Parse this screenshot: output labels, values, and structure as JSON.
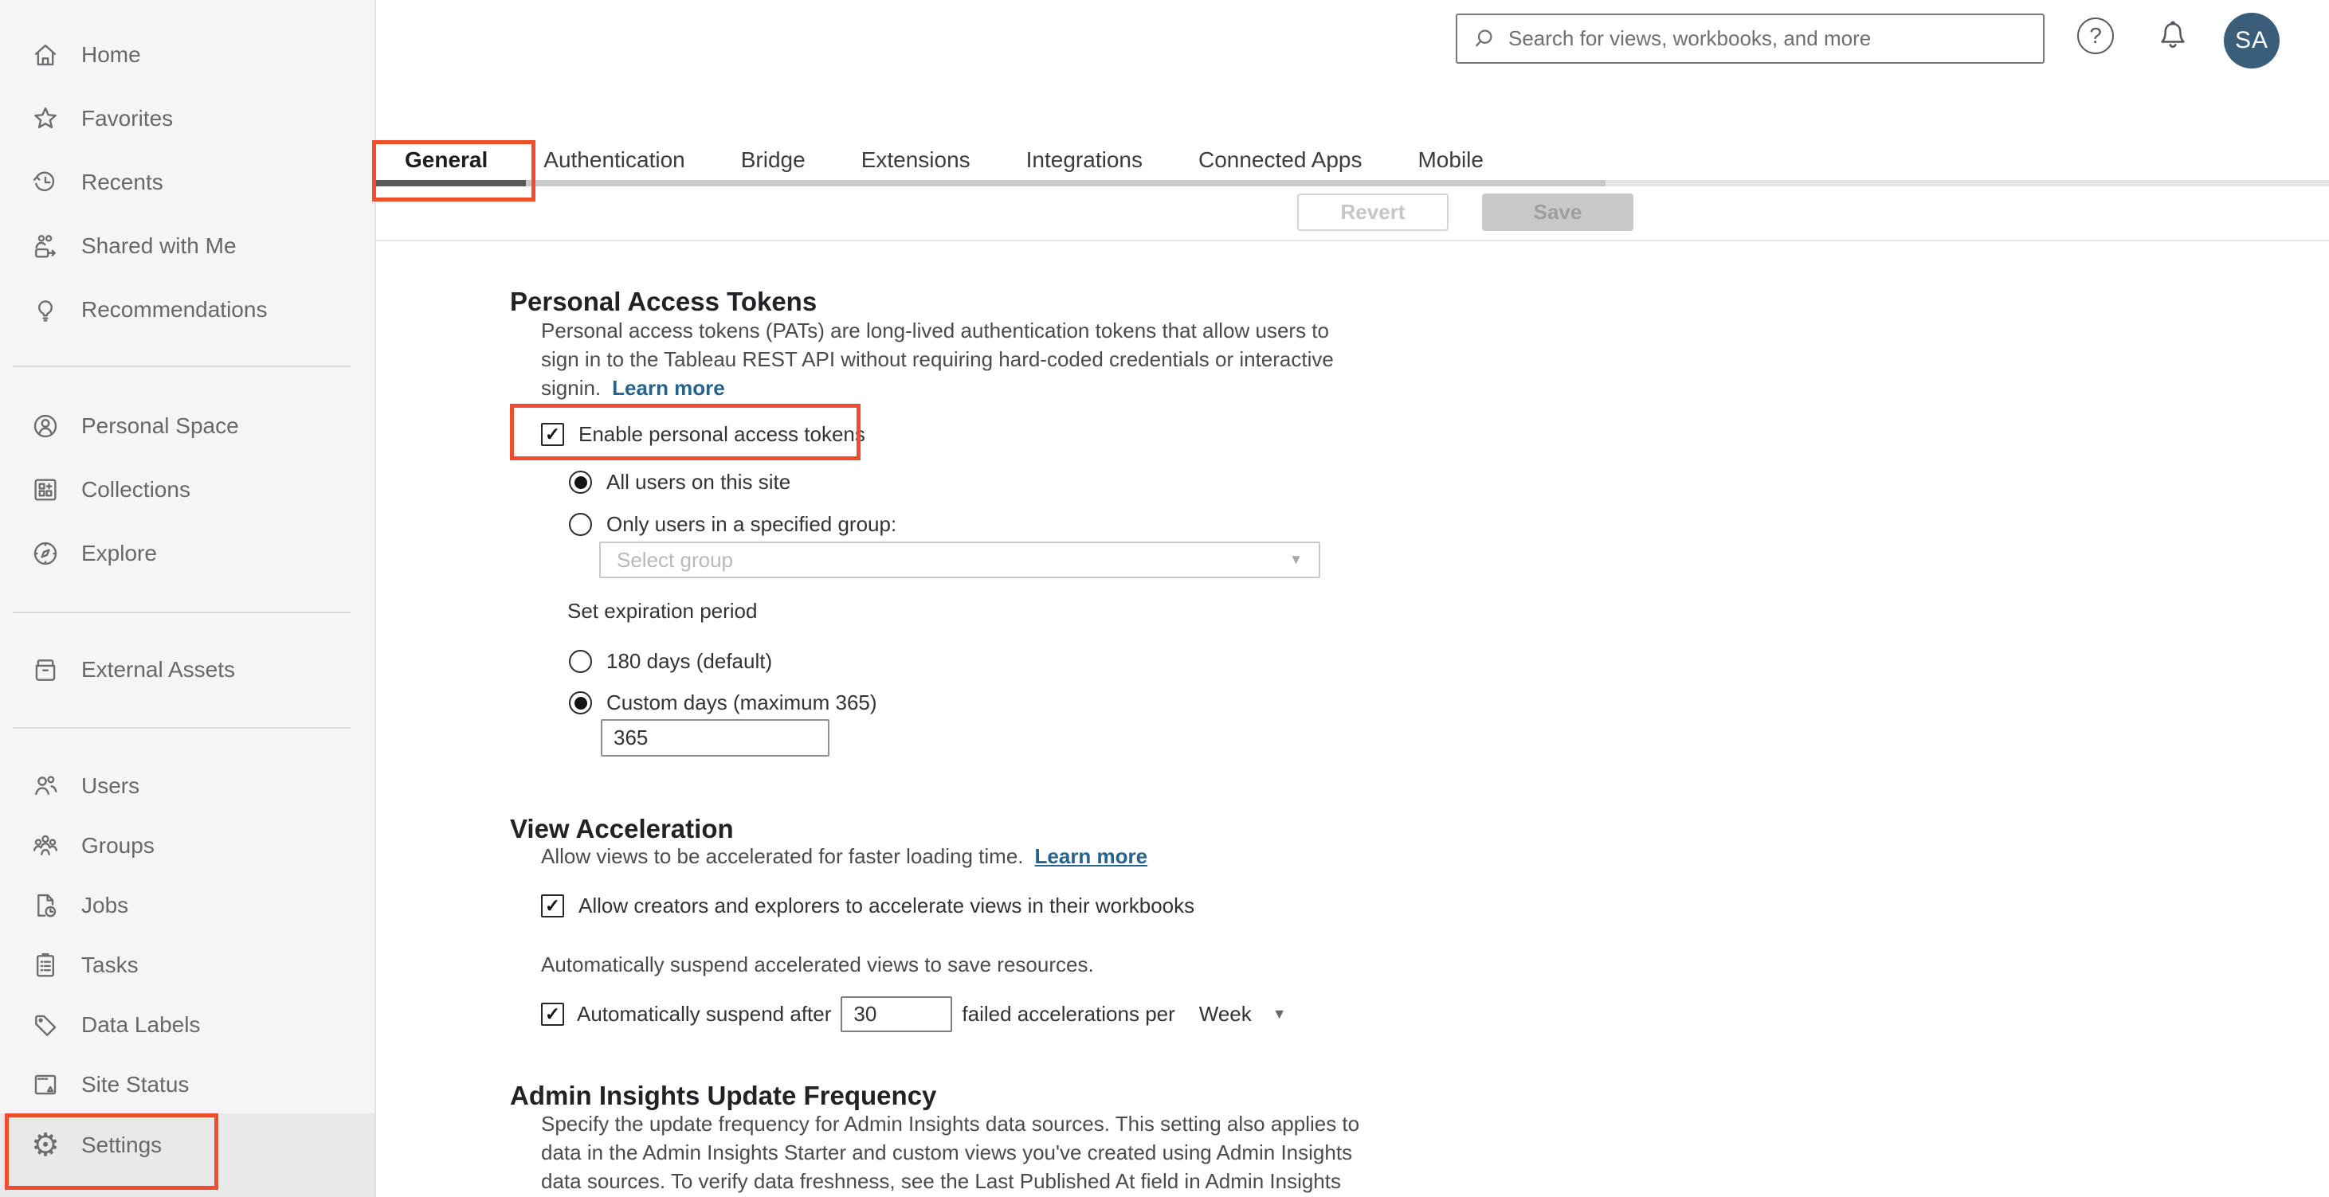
{
  "topbar": {
    "search_placeholder": "Search for views, workbooks, and more",
    "avatar_initials": "SA"
  },
  "icons": {
    "checkmark": "✓",
    "caret_down": "▼",
    "question_mark": "?",
    "settings_gear": "⚙"
  },
  "colors": {
    "annotation_red": "#ef4e2d",
    "link_blue": "#25638c",
    "avatar_bg": "#3a5e79",
    "sidebar_bg": "#f5f5f5",
    "selected_row_bg": "#e9e9e9"
  },
  "sidebar": {
    "items": [
      {
        "label": "Home"
      },
      {
        "label": "Favorites"
      },
      {
        "label": "Recents"
      },
      {
        "label": "Shared with Me"
      },
      {
        "label": "Recommendations"
      },
      {
        "label": "Personal Space"
      },
      {
        "label": "Collections"
      },
      {
        "label": "Explore"
      },
      {
        "label": "External Assets"
      },
      {
        "label": "Users"
      },
      {
        "label": "Groups"
      },
      {
        "label": "Jobs"
      },
      {
        "label": "Tasks"
      },
      {
        "label": "Data Labels"
      },
      {
        "label": "Site Status"
      },
      {
        "label": "Settings",
        "selected": true
      }
    ]
  },
  "tabs": {
    "items": [
      {
        "label": "General",
        "active": true
      },
      {
        "label": "Authentication"
      },
      {
        "label": "Bridge"
      },
      {
        "label": "Extensions"
      },
      {
        "label": "Integrations"
      },
      {
        "label": "Connected Apps"
      },
      {
        "label": "Mobile"
      }
    ],
    "revert_label": "Revert",
    "save_label": "Save"
  },
  "sections": {
    "pat": {
      "title": "Personal Access Tokens",
      "desc_lines": [
        "Personal access tokens (PATs) are long-lived authentication tokens that allow users to",
        "sign in to the Tableau REST API without requiring hard-coded credentials or interactive",
        "signin."
      ],
      "learn_more": "Learn more",
      "enable_label": "Enable personal access tokens",
      "enable_checked": true,
      "radio_all_users": "All users on this site",
      "radio_all_users_selected": true,
      "radio_specified_group": "Only users in a specified group:",
      "group_placeholder": "Select group",
      "expiration_label": "Set expiration period",
      "radio_180": "180 days (default)",
      "radio_custom": "Custom days (maximum 365)",
      "radio_custom_selected": true,
      "custom_days_value": "365"
    },
    "view_acceleration": {
      "title": "View Acceleration",
      "desc": "Allow views to be accelerated for faster loading time.",
      "learn_more": "Learn more",
      "allow_label": "Allow creators and explorers to accelerate views in their workbooks",
      "allow_checked": true,
      "suspend_desc": "Automatically suspend accelerated views to save resources.",
      "suspend_prefix": "Automatically suspend after",
      "suspend_value": "30",
      "suspend_suffix": "failed accelerations per",
      "suspend_checked": true,
      "period_value": "Week"
    },
    "admin_insights": {
      "title": "Admin Insights Update Frequency",
      "desc_lines": [
        "Specify the update frequency for Admin Insights data sources. This setting also applies to",
        "data in the Admin Insights Starter and custom views you've created using Admin Insights",
        "data sources. To verify data freshness, see the Last Published At field in Admin Insights"
      ]
    }
  }
}
